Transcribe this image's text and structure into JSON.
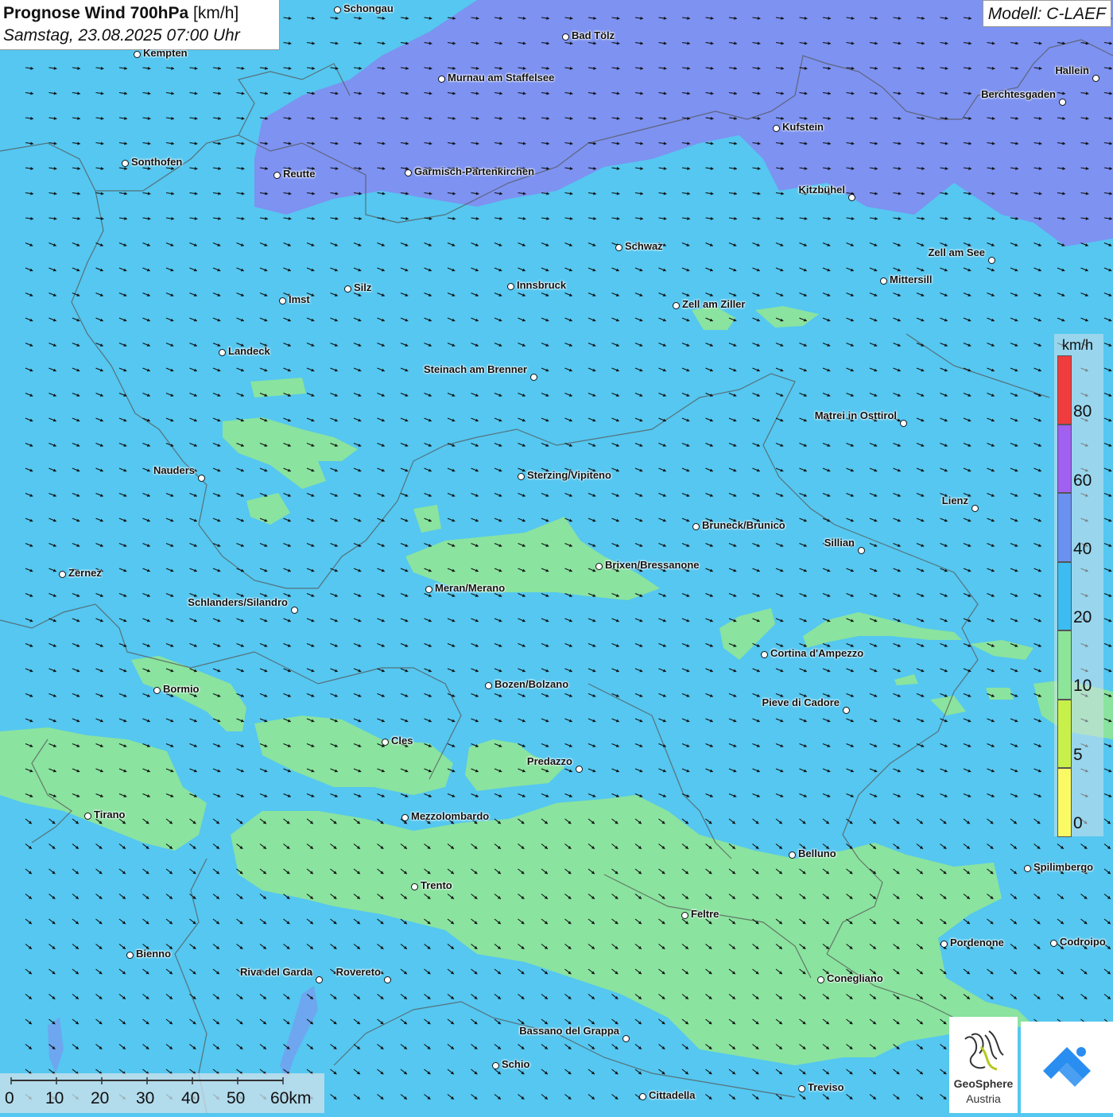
{
  "title": {
    "main": "Prognose Wind 700hPa",
    "unit": "[km/h]",
    "datetime": "Samstag, 23.08.2025 07:00 Uhr"
  },
  "model": "Modell: C-LAEF",
  "colors": {
    "background": "#55c7f0",
    "calm_zone": "#8de59a",
    "strong_zone": "#7f8ff0",
    "arrow": "#111111"
  },
  "legend": {
    "unit": "km/h",
    "ticks": [
      "80",
      "60",
      "40",
      "20",
      "10",
      "5",
      "0"
    ],
    "bands": [
      {
        "color": "#f03c3c"
      },
      {
        "color": "#a060f0"
      },
      {
        "color": "#6a90f0"
      },
      {
        "color": "#3cbcf0"
      },
      {
        "color": "#8de59a"
      },
      {
        "color": "#c8f04a"
      },
      {
        "color": "#fafa64"
      }
    ]
  },
  "scale": {
    "labels": [
      "0",
      "10",
      "20",
      "30",
      "40",
      "50",
      "60km"
    ]
  },
  "logo": {
    "name": "GeoSphere",
    "sub": "Austria",
    "icon": "geosphere-logo-icon",
    "second_icon": "warning-app-icon"
  },
  "cities": [
    {
      "name": "Schongau"
    },
    {
      "name": "Kempten"
    },
    {
      "name": "Bad Tölz"
    },
    {
      "name": "Murnau am Staffelsee"
    },
    {
      "name": "Hallein"
    },
    {
      "name": "Berchtesgaden"
    },
    {
      "name": "Kufstein"
    },
    {
      "name": "Sonthofen"
    },
    {
      "name": "Reutte"
    },
    {
      "name": "Garmisch-Partenkirchen"
    },
    {
      "name": "Kitzbühel"
    },
    {
      "name": "Schwaz"
    },
    {
      "name": "Zell am See"
    },
    {
      "name": "Mittersill"
    },
    {
      "name": "Silz"
    },
    {
      "name": "Innsbruck"
    },
    {
      "name": "Imst"
    },
    {
      "name": "Zell am Ziller"
    },
    {
      "name": "Landeck"
    },
    {
      "name": "Steinach am Brenner"
    },
    {
      "name": "Matrei in Osttirol"
    },
    {
      "name": "Nauders"
    },
    {
      "name": "Sterzing/Vipiteno"
    },
    {
      "name": "Lienz"
    },
    {
      "name": "Bruneck/Brunico"
    },
    {
      "name": "Sillian"
    },
    {
      "name": "Zernez"
    },
    {
      "name": "Brixen/Bressanone"
    },
    {
      "name": "Meran/Merano"
    },
    {
      "name": "Schlanders/Silandro"
    },
    {
      "name": "Cortina d'Ampezzo"
    },
    {
      "name": "Bormio"
    },
    {
      "name": "Bozen/Bolzano"
    },
    {
      "name": "Pieve di Cadore"
    },
    {
      "name": "Cles"
    },
    {
      "name": "Predazzo"
    },
    {
      "name": "Tirano"
    },
    {
      "name": "Mezzolombardo"
    },
    {
      "name": "Belluno"
    },
    {
      "name": "Spilimbergo"
    },
    {
      "name": "Trento"
    },
    {
      "name": "Feltre"
    },
    {
      "name": "Pordenone"
    },
    {
      "name": "Codroipo"
    },
    {
      "name": "Bienno"
    },
    {
      "name": "Riva del Garda"
    },
    {
      "name": "Rovereto"
    },
    {
      "name": "Conegliano"
    },
    {
      "name": "Bassano del Grappa"
    },
    {
      "name": "Schio"
    },
    {
      "name": "Treviso"
    },
    {
      "name": "Cittadella"
    }
  ]
}
